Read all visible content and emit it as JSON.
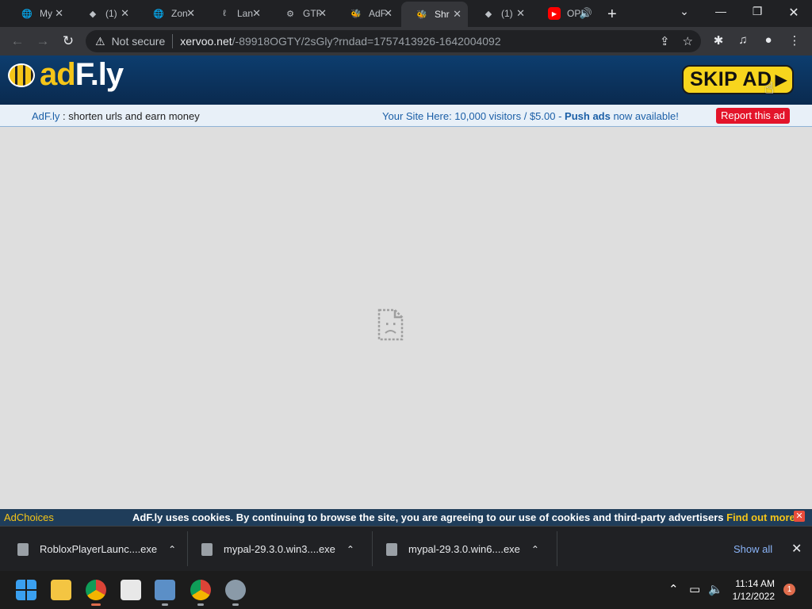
{
  "browser": {
    "tabs": [
      {
        "title": "My",
        "favicon": "globe-icon"
      },
      {
        "title": "(1)",
        "favicon": "roblox-icon"
      },
      {
        "title": "Zon",
        "favicon": "globe-icon"
      },
      {
        "title": "Lan",
        "favicon": "lan-icon"
      },
      {
        "title": "GTF",
        "favicon": "steam-icon"
      },
      {
        "title": "AdF",
        "favicon": "bee-icon"
      },
      {
        "title": "Shr",
        "favicon": "bee-icon"
      },
      {
        "title": "(1)",
        "favicon": "roblox-icon"
      },
      {
        "title": "OPI",
        "favicon": "youtube-icon"
      }
    ],
    "active_tab_index": 6,
    "security_label": "Not secure",
    "url_host": "xervoo.net",
    "url_path": "/-89918OGTY/2sGly?rndad=1757413926-1642004092"
  },
  "adfly": {
    "logo_ad": "ad",
    "logo_fly": "F.ly",
    "skip_label": "SKIP AD",
    "brand": "AdF.ly",
    "tagline": " : shorten urls and earn money",
    "promo_prefix": "Your Site Here: 10,000 visitors / $5.00 - ",
    "promo_bold": "Push ads",
    "promo_suffix": " now available!",
    "report_label": "Report this ad"
  },
  "cookie": {
    "adchoices": "AdChoices",
    "text": "AdF.ly uses cookies. By continuing to browse the site, you are agreeing to our use of cookies and third-party advertisers ",
    "link": "Find out more",
    "period": "."
  },
  "downloads": {
    "items": [
      {
        "name": "RobloxPlayerLaunc....exe"
      },
      {
        "name": "mypal-29.3.0.win3....exe"
      },
      {
        "name": "mypal-29.3.0.win6....exe"
      }
    ],
    "show_all": "Show all"
  },
  "taskbar": {
    "time": "11:14 AM",
    "date": "1/12/2022",
    "notification_count": "1"
  },
  "colors": {
    "skip_yellow": "#f7d51d",
    "report_red": "#e3142a",
    "header_blue": "#0d3d6e"
  }
}
